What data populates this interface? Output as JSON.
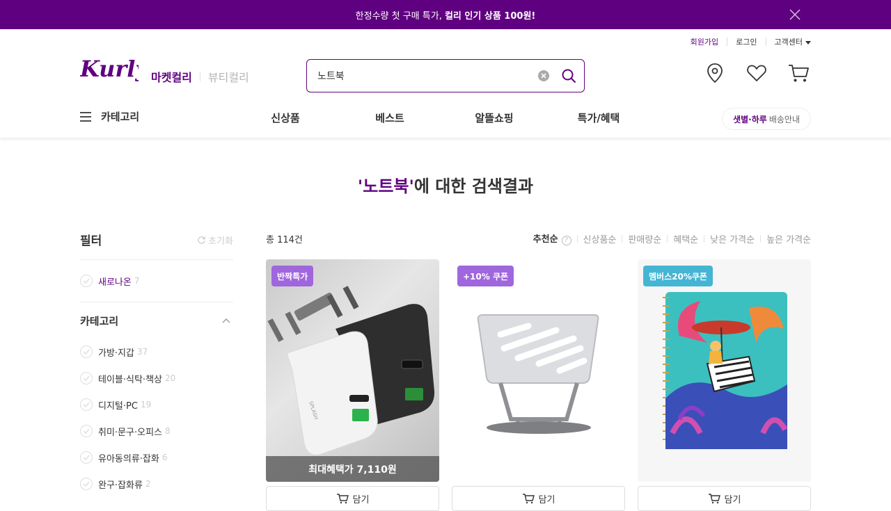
{
  "banner": {
    "text_plain": "한정수량 첫 구매 특가, ",
    "text_bold": "컬리 인기 상품 100원!"
  },
  "top_links": {
    "signup": "회원가입",
    "login": "로그인",
    "customer_center": "고객센터"
  },
  "header": {
    "mall_active": "마켓컬리",
    "mall_inactive": "뷰티컬리"
  },
  "search": {
    "value": "노트북"
  },
  "gnb": {
    "category": "카테고리",
    "menu": [
      "신상품",
      "베스트",
      "알뜰쇼핑",
      "특가/혜택"
    ],
    "delivery_bold": "샛별·하루",
    "delivery_text": "배송안내"
  },
  "result": {
    "keyword_quoted": "'노트북'",
    "suffix": "에 대한 검색결과"
  },
  "filter": {
    "title": "필터",
    "reset": "초기화",
    "newbie": {
      "label": "새로나온",
      "count": "7"
    },
    "category_title": "카테고리",
    "categories": [
      {
        "label": "가방·지갑",
        "count": "37"
      },
      {
        "label": "테이블·식탁·책상",
        "count": "20"
      },
      {
        "label": "디지털·PC",
        "count": "19"
      },
      {
        "label": "취미·문구·오피스",
        "count": "8"
      },
      {
        "label": "유아동의류·잡화",
        "count": "6"
      },
      {
        "label": "완구·잡화류",
        "count": "2"
      }
    ]
  },
  "list": {
    "total": "총 114건",
    "sorts": [
      "추천순",
      "신상품순",
      "판매량순",
      "혜택순",
      "낮은 가격순",
      "높은 가격순"
    ]
  },
  "products": [
    {
      "tag": "반짝특가",
      "tag_color": "#a066dd",
      "bottom": "최대혜택가 7,110원",
      "cart": "담기"
    },
    {
      "tag": "+10% 쿠폰",
      "tag_color": "#a066dd",
      "cart": "담기"
    },
    {
      "tag": "멤버스20%쿠폰",
      "tag_color": "#44b5d3",
      "cart": "담기"
    }
  ],
  "colors": {
    "brand": "#5f0080",
    "tag_purple": "#a066dd",
    "tag_teal": "#44b5d3"
  }
}
